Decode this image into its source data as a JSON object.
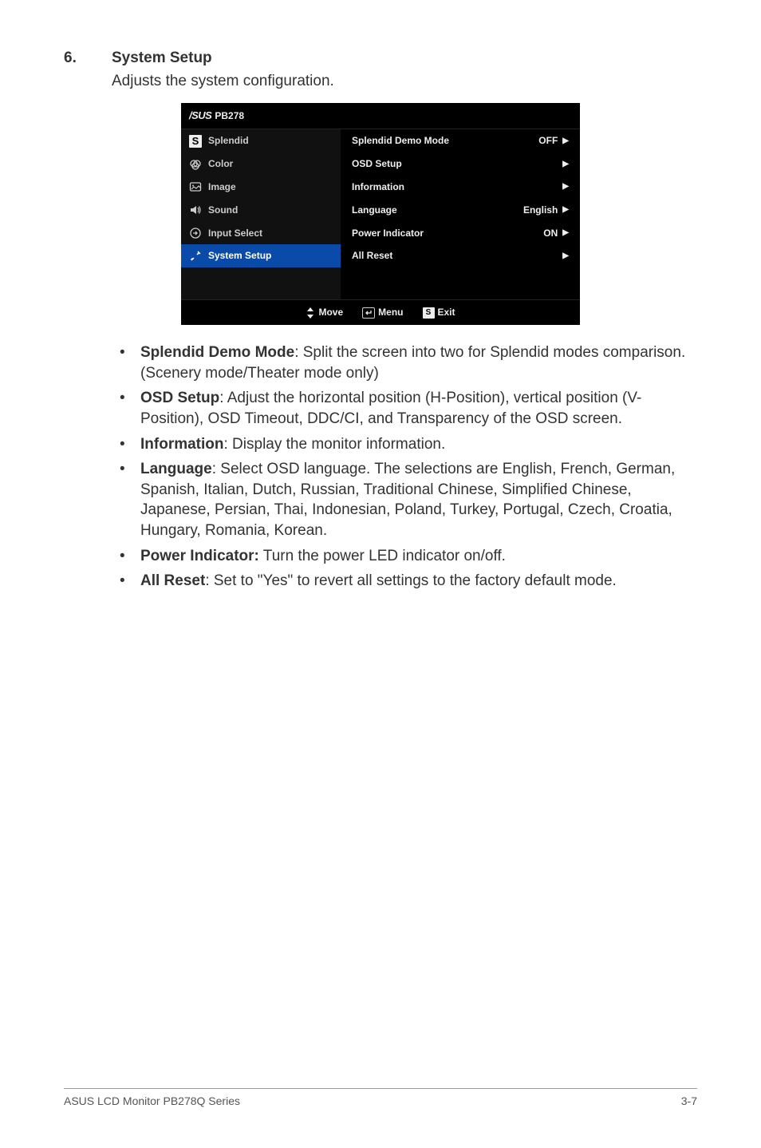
{
  "heading": {
    "num": "6.",
    "title": "System Setup",
    "subtitle": "Adjusts the system configuration."
  },
  "osd": {
    "logo": "/SUS",
    "model": "PB278",
    "left": {
      "items": [
        {
          "label": "Splendid"
        },
        {
          "label": "Color"
        },
        {
          "label": "Image"
        },
        {
          "label": "Sound"
        },
        {
          "label": "Input Select"
        },
        {
          "label": "System Setup"
        }
      ]
    },
    "right": {
      "rows": [
        {
          "label": "Splendid Demo Mode",
          "value": "OFF"
        },
        {
          "label": "OSD Setup",
          "value": ""
        },
        {
          "label": "Information",
          "value": ""
        },
        {
          "label": "Language",
          "value": "English"
        },
        {
          "label": "Power Indicator",
          "value": "ON"
        },
        {
          "label": "All Reset",
          "value": ""
        }
      ]
    },
    "footer": {
      "move": "Move",
      "menu": "Menu",
      "exit": "Exit",
      "s": "S"
    }
  },
  "bullets": {
    "b1_t": "Splendid Demo Mode",
    "b1_r": ": Split the screen into two for Splendid modes comparison. (Scenery mode/Theater mode only)",
    "b2_t": "OSD Setup",
    "b2_r": ": Adjust the horizontal position (H-Position), vertical position (V-Position), OSD Timeout, DDC/CI, and Transparency of the OSD screen.",
    "b3_t": "Information",
    "b3_r": ": Display the monitor information.",
    "b4_t": "Language",
    "b4_r": ": Select OSD language. The selections are English, French, German, Spanish, Italian, Dutch, Russian, Traditional Chinese, Simplified Chinese, Japanese, Persian, Thai, Indonesian, Poland, Turkey, Portugal, Czech, Croatia, Hungary, Romania, Korean.",
    "b5_t": "Power Indicator:",
    "b5_r": " Turn the power LED indicator on/off.",
    "b6_t": "All Reset",
    "b6_r": ": Set to \"Yes\" to revert all settings to the factory default mode."
  },
  "footer": {
    "left": "ASUS LCD Monitor PB278Q Series",
    "right": "3-7"
  }
}
